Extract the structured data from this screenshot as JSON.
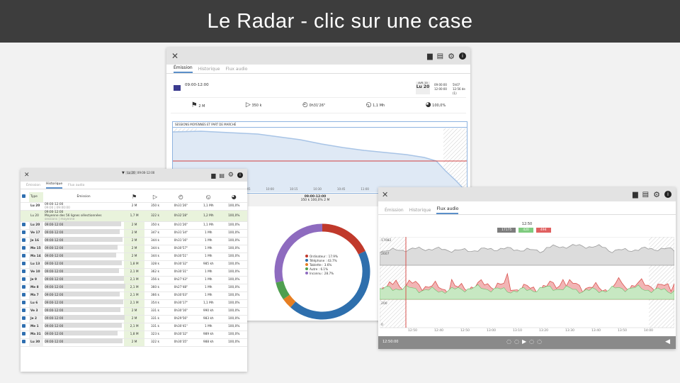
{
  "banner": {
    "title": "Le Radar - clic sur une case"
  },
  "win_main": {
    "tabs": [
      "Émission",
      "Historique",
      "Flux audio"
    ],
    "time_range": "09:00-12:00",
    "date_day": "Lu 20",
    "date_month": "AVR. 20",
    "times": [
      "09:00:00",
      "12:00:00"
    ],
    "extra": [
      "5h07",
      "12:56 de (1)"
    ],
    "stats": [
      {
        "icon": "flag",
        "value": "2 M"
      },
      {
        "icon": "play",
        "value": "350 k"
      },
      {
        "icon": "timer",
        "value": "0h31'26\""
      },
      {
        "icon": "timer-plus",
        "value": "1,1 Mh"
      },
      {
        "icon": "pie",
        "value": "100,0%"
      }
    ],
    "chart_title": "SESSIONS MOYENNES ET PART DE MARCHÉ",
    "x_ticks": [
      "09:15",
      "09:30",
      "09:45",
      "10:00",
      "10:15",
      "10:30",
      "10:45",
      "11:00",
      "11:15",
      "11:30",
      "11:45",
      "12:00"
    ],
    "donut_header": "09:00-12:00",
    "donut_sub": "350 k  100,0%  2 M",
    "legend": [
      {
        "label": "Ordinateur : 17.9%",
        "color": "#c0392b",
        "value": 17.9
      },
      {
        "label": "Téléphone : 43.7%",
        "color": "#2e6fad",
        "value": 43.7
      },
      {
        "label": "Tablette : 3.6%",
        "color": "#e67e22",
        "value": 3.6
      },
      {
        "label": "Autre : 6.1%",
        "color": "#4f9f4f",
        "value": 6.1
      },
      {
        "label": "Inconnu : 28.7%",
        "color": "#8e6bbf",
        "value": 28.7
      }
    ]
  },
  "win_left": {
    "tabs": [
      "Émission",
      "Historique",
      "Flux audio"
    ],
    "header_date": "Lu 20",
    "header_range": "09:00-12:00",
    "col_type": "Type",
    "col_emission": "Émission",
    "summary": {
      "date": "Lu 20",
      "time": "09:00-12:00",
      "label": "Moyenne des 56 lignes sélectionnées",
      "sub": "sessions | moyenne",
      "v1": "1,7 M",
      "v2": "322 k",
      "v3": "0h32'28\"",
      "v4": "1,2 Mh",
      "v5": "100,0%"
    },
    "first": {
      "date": "Lu 20",
      "time": "09:00-12:00",
      "sub": "09:00 | 09:00:00",
      "v1": "2 M",
      "v2": "350 k",
      "v3": "0h31'26\"",
      "v4": "1,1 Mh",
      "v5": "100,0%"
    },
    "rows": [
      {
        "d": "Lu 20",
        "v1": "2 M",
        "v2": "350 k",
        "v3": "0h31'26\"",
        "v4": "1,1 Mh",
        "v5": "100,0%"
      },
      {
        "d": "Ve 17",
        "v1": "2 M",
        "v2": "347 k",
        "v3": "0h31'34\"",
        "v4": "1 Mh",
        "v5": "100,0%"
      },
      {
        "d": "Je 16",
        "v1": "2 M",
        "v2": "344 k",
        "v3": "0h31'16\"",
        "v4": "1 Mh",
        "v5": "100,0%"
      },
      {
        "d": "Me 15",
        "v1": "2 M",
        "v2": "344 k",
        "v3": "0h30'57\"",
        "v4": "1 Mh",
        "v5": "100,0%"
      },
      {
        "d": "Ma 14",
        "v1": "2 M",
        "v2": "344 k",
        "v3": "0h30'51\"",
        "v4": "1 Mh",
        "v5": "100,0%"
      },
      {
        "d": "Lu 13",
        "v1": "1,8 M",
        "v2": "328 k",
        "v3": "0h30'32\"",
        "v4": "985 kh",
        "v5": "100,0%"
      },
      {
        "d": "Ve 10",
        "v1": "2,1 M",
        "v2": "362 k",
        "v3": "0h30'31\"",
        "v4": "1 Mh",
        "v5": "100,0%"
      },
      {
        "d": "Je 9",
        "v1": "2,1 M",
        "v2": "356 k",
        "v3": "0h27'43\"",
        "v4": "1 Mh",
        "v5": "100,0%"
      },
      {
        "d": "Me 8",
        "v1": "2,1 M",
        "v2": "360 k",
        "v3": "0h27'48\"",
        "v4": "1 Mh",
        "v5": "100,0%"
      },
      {
        "d": "Ma 7",
        "v1": "2,1 M",
        "v2": "366 k",
        "v3": "0h30'03\"",
        "v4": "1 Mh",
        "v5": "100,0%"
      },
      {
        "d": "Lu 6",
        "v1": "2,1 M",
        "v2": "354 k",
        "v3": "0h30'17\"",
        "v4": "1,1 Mh",
        "v5": "100,0%"
      },
      {
        "d": "Ve 3",
        "v1": "2 M",
        "v2": "331 k",
        "v3": "0h30'16\"",
        "v4": "990 kh",
        "v5": "100,0%"
      },
      {
        "d": "Je 2",
        "v1": "2 M",
        "v2": "331 k",
        "v3": "0h29'56\"",
        "v4": "983 kh",
        "v5": "100,0%"
      },
      {
        "d": "Me 1",
        "v1": "2,1 M",
        "v2": "331 k",
        "v3": "0h30'41\"",
        "v4": "1 Mh",
        "v5": "100,0%"
      },
      {
        "d": "Ma 31",
        "v1": "1,8 M",
        "v2": "323 k",
        "v3": "0h30'32\"",
        "v4": "989 kh",
        "v5": "100,0%"
      },
      {
        "d": "Lu 30",
        "v1": "2 M",
        "v2": "322 k",
        "v3": "0h30'35\"",
        "v4": "988 kh",
        "v5": "100,0%"
      }
    ]
  },
  "win_audio": {
    "tabs": [
      "Émission",
      "Historique",
      "Flux audio"
    ],
    "time_label": "12:50",
    "badges": [
      {
        "text": "17175",
        "color": "#7d7d7d"
      },
      {
        "text": "420",
        "color": "#7fcb7f"
      },
      {
        "text": "494",
        "color": "#e06060"
      }
    ],
    "y_labels": [
      "17082",
      "2607",
      "200",
      "0"
    ],
    "x_ticks": [
      "12:50",
      "12:40",
      "12:50",
      "13:00",
      "13:10",
      "13:20",
      "13:30",
      "13:40",
      "13:50",
      "14:00"
    ],
    "current_time": "12:50:00"
  }
}
